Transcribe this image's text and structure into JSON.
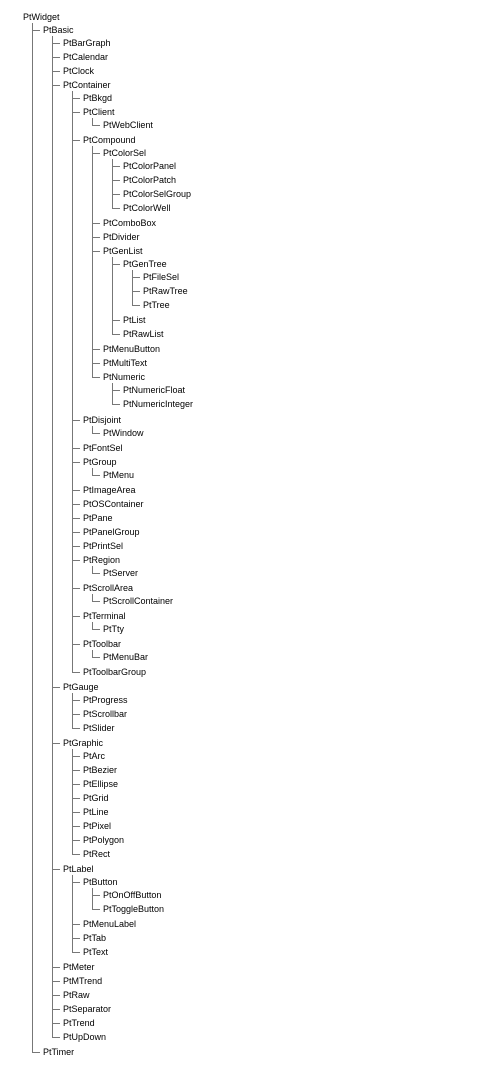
{
  "tree": {
    "name": "PtWidget",
    "children": [
      {
        "name": "PtBasic",
        "children": [
          {
            "name": "PtBarGraph"
          },
          {
            "name": "PtCalendar"
          },
          {
            "name": "PtClock"
          },
          {
            "name": "PtContainer",
            "children": [
              {
                "name": "PtBkgd"
              },
              {
                "name": "PtClient",
                "children": [
                  {
                    "name": "PtWebClient"
                  }
                ]
              },
              {
                "name": "PtCompound",
                "children": [
                  {
                    "name": "PtColorSel",
                    "children": [
                      {
                        "name": "PtColorPanel"
                      },
                      {
                        "name": "PtColorPatch"
                      },
                      {
                        "name": "PtColorSelGroup"
                      },
                      {
                        "name": "PtColorWell"
                      }
                    ]
                  },
                  {
                    "name": "PtComboBox"
                  },
                  {
                    "name": "PtDivider"
                  },
                  {
                    "name": "PtGenList",
                    "children": [
                      {
                        "name": "PtGenTree",
                        "children": [
                          {
                            "name": "PtFileSel"
                          },
                          {
                            "name": "PtRawTree"
                          },
                          {
                            "name": "PtTree"
                          }
                        ]
                      },
                      {
                        "name": "PtList"
                      },
                      {
                        "name": "PtRawList"
                      }
                    ]
                  },
                  {
                    "name": "PtMenuButton"
                  },
                  {
                    "name": "PtMultiText"
                  },
                  {
                    "name": "PtNumeric",
                    "children": [
                      {
                        "name": "PtNumericFloat"
                      },
                      {
                        "name": "PtNumericInteger"
                      }
                    ]
                  }
                ]
              },
              {
                "name": "PtDisjoint",
                "children": [
                  {
                    "name": "PtWindow"
                  }
                ]
              },
              {
                "name": "PtFontSel"
              },
              {
                "name": "PtGroup",
                "children": [
                  {
                    "name": "PtMenu"
                  }
                ]
              },
              {
                "name": "PtImageArea"
              },
              {
                "name": "PtOSContainer"
              },
              {
                "name": "PtPane"
              },
              {
                "name": "PtPanelGroup"
              },
              {
                "name": "PtPrintSel"
              },
              {
                "name": "PtRegion",
                "children": [
                  {
                    "name": "PtServer"
                  }
                ]
              },
              {
                "name": "PtScrollArea",
                "children": [
                  {
                    "name": "PtScrollContainer"
                  }
                ]
              },
              {
                "name": "PtTerminal",
                "children": [
                  {
                    "name": "PtTty"
                  }
                ]
              },
              {
                "name": "PtToolbar",
                "children": [
                  {
                    "name": "PtMenuBar"
                  }
                ]
              },
              {
                "name": "PtToolbarGroup"
              }
            ]
          },
          {
            "name": "PtGauge",
            "children": [
              {
                "name": "PtProgress"
              },
              {
                "name": "PtScrollbar"
              },
              {
                "name": "PtSlider"
              }
            ]
          },
          {
            "name": "PtGraphic",
            "children": [
              {
                "name": "PtArc"
              },
              {
                "name": "PtBezier"
              },
              {
                "name": "PtEllipse"
              },
              {
                "name": "PtGrid"
              },
              {
                "name": "PtLine"
              },
              {
                "name": "PtPixel"
              },
              {
                "name": "PtPolygon"
              },
              {
                "name": "PtRect"
              }
            ]
          },
          {
            "name": "PtLabel",
            "children": [
              {
                "name": "PtButton",
                "children": [
                  {
                    "name": "PtOnOffButton"
                  },
                  {
                    "name": "PtToggleButton"
                  }
                ]
              },
              {
                "name": "PtMenuLabel"
              },
              {
                "name": "PtTab"
              },
              {
                "name": "PtText"
              }
            ]
          },
          {
            "name": "PtMeter"
          },
          {
            "name": "PtMTrend"
          },
          {
            "name": "PtRaw"
          },
          {
            "name": "PtSeparator"
          },
          {
            "name": "PtTrend"
          },
          {
            "name": "PtUpDown"
          }
        ]
      },
      {
        "name": "PtTimer"
      }
    ]
  }
}
